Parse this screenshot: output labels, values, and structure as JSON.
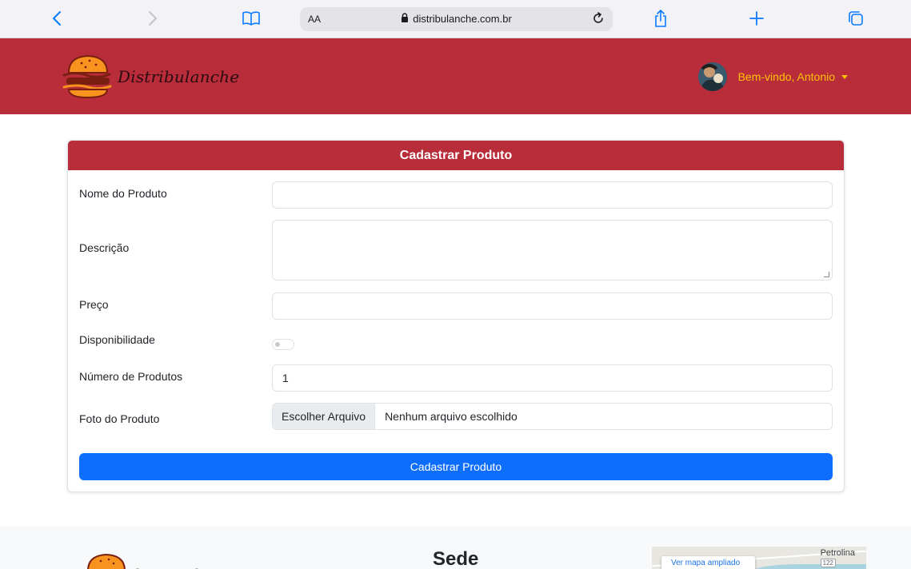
{
  "browser": {
    "aa_label": "AA",
    "url": "distribulanche.com.br"
  },
  "header": {
    "brand": "Distribulanche",
    "welcome": "Bem-vindo, Antonio"
  },
  "form": {
    "title": "Cadastrar Produto",
    "fields": {
      "name_label": "Nome do Produto",
      "name_value": "",
      "description_label": "Descrição",
      "description_value": "",
      "price_label": "Preço",
      "price_value": "",
      "availability_label": "Disponibilidade",
      "availability_on": false,
      "quantity_label": "Número de Produtos",
      "quantity_value": "1",
      "photo_label": "Foto do Produto",
      "file_button": "Escolher Arquivo",
      "file_status": "Nenhum arquivo escolhido"
    },
    "submit_label": "Cadastrar Produto"
  },
  "footer": {
    "sede_title": "Sede",
    "map_city": "Petrolina",
    "map_route": "122",
    "map_link": "Ver mapa ampliado"
  },
  "colors": {
    "brand_red": "#b92d3a",
    "welcome_yellow": "#ffc107",
    "primary_blue": "#0d6efd",
    "safari_blue": "#0a7aff"
  },
  "icons": [
    "chevron-left-icon",
    "chevron-right-icon",
    "bookmarks-icon",
    "lock-icon",
    "reload-icon",
    "share-icon",
    "plus-icon",
    "tabs-icon",
    "burger-logo-icon",
    "caret-down-icon"
  ]
}
